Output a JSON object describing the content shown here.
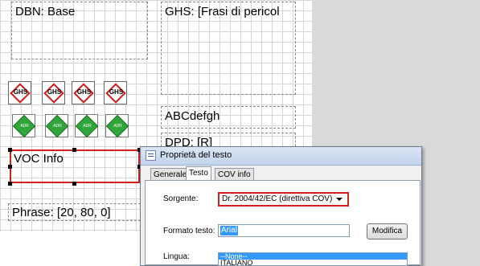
{
  "canvas": {
    "fields": {
      "dbn": "DBN: Base",
      "ghs": "GHS: [Frasi di pericol",
      "abc": "ABCdefgh",
      "dpd": "DPD: [R]",
      "voc": "VOC Info",
      "phrase": "Phrase: [20, 80, 0]"
    },
    "ghs_label": "GHS",
    "adr_label": "ADR"
  },
  "dialog": {
    "title": "Proprietà del testo",
    "tabs": [
      "Generale",
      "Testo",
      "COV info"
    ],
    "active_tab": "Testo",
    "source_label": "Sorgente:",
    "source_value": "Dr. 2004/42/EC (direttiva COV)",
    "format_label": "Formato testo:",
    "format_value": "Arial",
    "modify_button": "Modifica",
    "language_label": "Lingua:",
    "language_options": [
      "--None--",
      "ITALIANO"
    ],
    "language_selected": "--None--"
  },
  "colors": {
    "selection_red": "#d0211a",
    "ghs_red": "#d01c1c",
    "adr_green": "#2fa53a",
    "highlight_blue": "#3399ff"
  }
}
